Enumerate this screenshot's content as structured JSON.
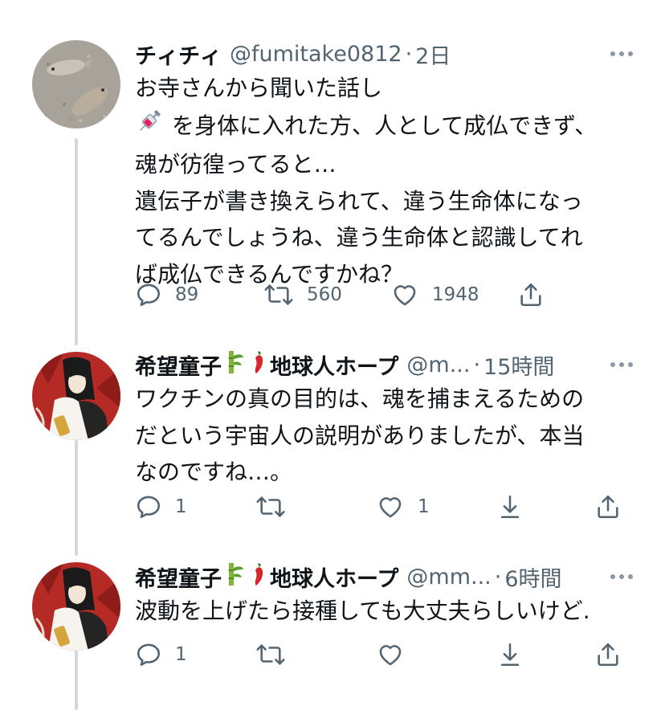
{
  "tweets": [
    {
      "name": "チィチィ",
      "handle": "@fumitake0812",
      "dot": "·",
      "time": "2日",
      "body_lines": [
        "お寺さんから聞いた話し",
        "を身体に入れた方、人として成仏できず、",
        "魂が彷徨ってると…",
        "遺伝子が書き換えられて、違う生命体になっ",
        "てるんでしょうね、違う生命体と認識してれ",
        "ば成仏できるんですかね？"
      ],
      "body_icon": "syringe-emoji",
      "actions": {
        "reply_count": "89",
        "retweet_count": "560",
        "like_count": "1948"
      }
    },
    {
      "name": "希望童子",
      "name_suffix": "地球人ホープ",
      "name_icons": [
        "bamboo-emoji",
        "chili-pepper-emoji"
      ],
      "handle": "@m...",
      "dot": "·",
      "time": "15時間",
      "body_lines": [
        "ワクチンの真の目的は、魂を捕まえるための",
        "だという宇宙人の説明がありましたが、本当",
        "なのですね…。"
      ],
      "actions": {
        "reply_count": "1",
        "retweet_count": "",
        "like_count": "1"
      }
    },
    {
      "name": "希望童子",
      "name_suffix": "地球人ホープ",
      "name_icons": [
        "bamboo-emoji",
        "chili-pepper-emoji"
      ],
      "handle": "@mm...",
      "dot": "·",
      "time": "6時間",
      "body_lines": [
        "波動を上げたら接種しても大丈夫らしいけど."
      ],
      "actions": {
        "reply_count": "1",
        "retweet_count": "",
        "like_count": ""
      }
    }
  ],
  "colors": {
    "text": "#0f1419",
    "secondary": "#536471",
    "thread_line": "#cfd9de"
  }
}
